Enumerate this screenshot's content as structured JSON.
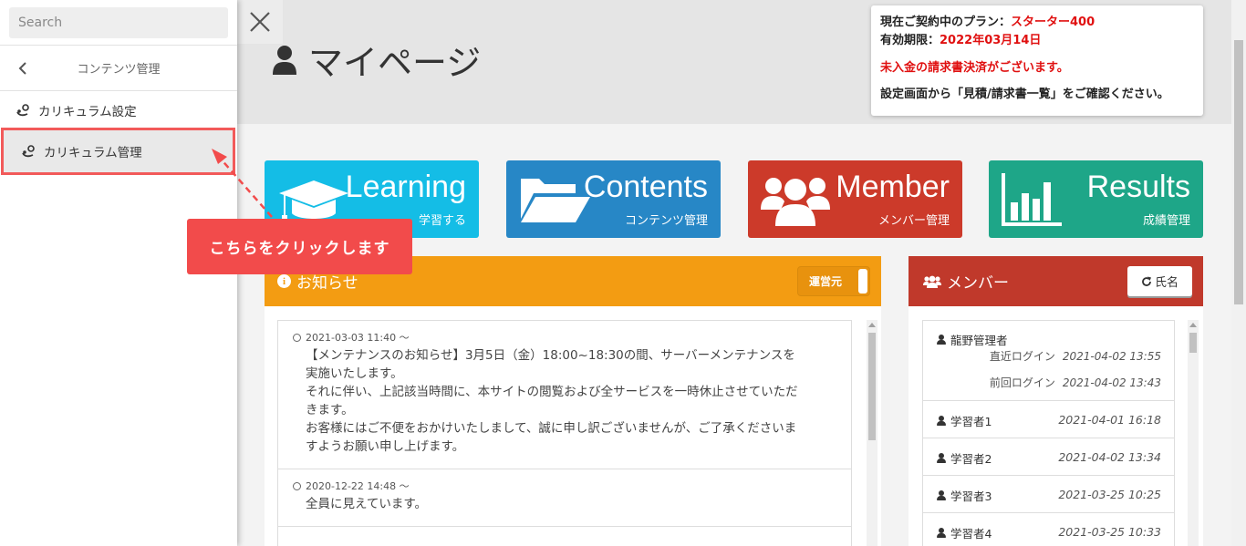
{
  "sidebar": {
    "search_placeholder": "Search",
    "nav_title": "コンテンツ管理",
    "items": [
      {
        "label": "カリキュラム設定"
      },
      {
        "label": "カリキュラム管理"
      }
    ]
  },
  "annotation": {
    "text": "こちらをクリックします"
  },
  "page": {
    "title": "マイページ"
  },
  "plan": {
    "plan_label": "現在ご契約中のプラン：",
    "plan_value": "スターター400",
    "expiry_label": "有効期限：",
    "expiry_value": "2022年03月14日",
    "warning": "未入金の請求書決済がございます。",
    "instruction": "設定画面から「見積/請求書一覧」をご確認ください。"
  },
  "tiles": [
    {
      "title": "Learning",
      "subtitle": "学習する"
    },
    {
      "title": "Contents",
      "subtitle": "コンテンツ管理"
    },
    {
      "title": "Member",
      "subtitle": "メンバー管理"
    },
    {
      "title": "Results",
      "subtitle": "成績管理"
    }
  ],
  "notices": {
    "title": "お知らせ",
    "toggle_label": "運営元",
    "items": [
      {
        "date": "2021-03-03 11:40 ～",
        "lines": [
          "【メンテナンスのお知らせ】3月5日（金）18:00~18:30の間、サーバーメンテナンスを",
          "実施いたします。",
          "それに伴い、上記該当時間に、本サイトの閲覧および全サービスを一時休止させていただ",
          "きます。",
          "お客様にはご不便をおかけいたしまして、誠に申し訳ございませんが、ご了承くださいま",
          "すようお願い申し上げます。"
        ]
      },
      {
        "date": "2020-12-22 14:48 ～",
        "lines": [
          "全員に見えています。"
        ]
      }
    ]
  },
  "members": {
    "title": "メンバー",
    "sort_label": "氏名",
    "rows": [
      {
        "name": "龍野管理者",
        "recent_label": "直近ログイン",
        "recent": "2021-04-02 13:55",
        "prev_label": "前回ログイン",
        "prev": "2021-04-02 13:43"
      },
      {
        "name": "学習者1",
        "time": "2021-04-01 16:18"
      },
      {
        "name": "学習者2",
        "time": "2021-04-02 13:34"
      },
      {
        "name": "学習者3",
        "time": "2021-03-25 10:25"
      },
      {
        "name": "学習者4",
        "time": "2021-03-25 10:33"
      }
    ]
  },
  "colors": {
    "learning": "#14bde6",
    "contents": "#2787c6",
    "member": "#cc3a2a",
    "results": "#1ea688",
    "notice": "#f39c12",
    "members_head": "#c0392b",
    "highlight": "#f25a5a"
  }
}
